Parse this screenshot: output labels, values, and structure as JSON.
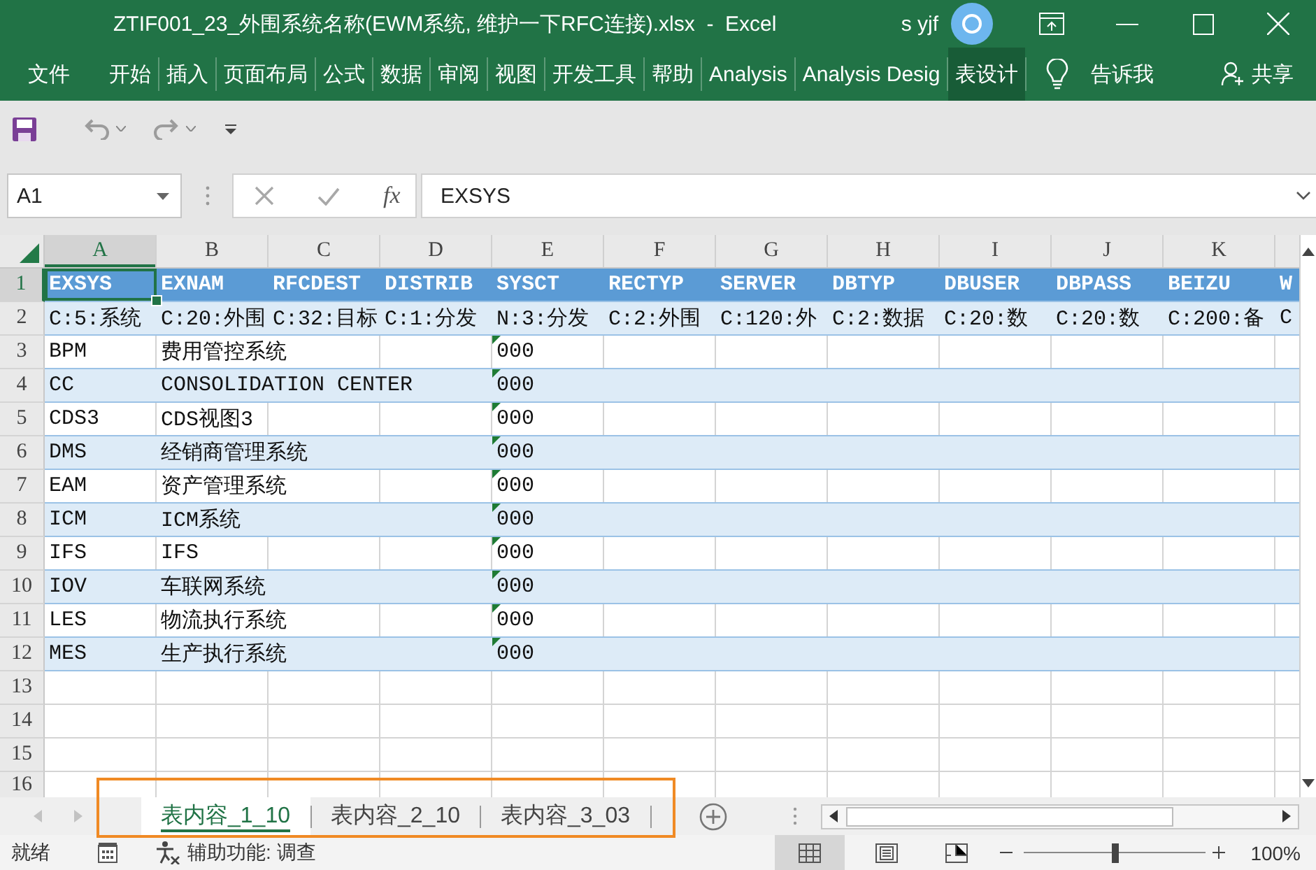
{
  "window": {
    "title": "ZTIF001_23_外围系统名称(EWM系统, 维护一下RFC连接).xlsx  -  Excel",
    "user_name": "s yjf"
  },
  "ribbon": {
    "tabs": [
      {
        "label": "文件",
        "selected": false
      },
      {
        "label": "开始",
        "selected": false
      },
      {
        "label": "插入",
        "selected": false
      },
      {
        "label": "页面布局",
        "selected": false
      },
      {
        "label": "公式",
        "selected": false
      },
      {
        "label": "数据",
        "selected": false
      },
      {
        "label": "审阅",
        "selected": false
      },
      {
        "label": "视图",
        "selected": false
      },
      {
        "label": "开发工具",
        "selected": false
      },
      {
        "label": "帮助",
        "selected": false
      },
      {
        "label": "Analysis",
        "selected": false
      },
      {
        "label": "Analysis Desig",
        "selected": false
      },
      {
        "label": "表设计",
        "selected": true
      }
    ],
    "tell_me": "告诉我",
    "share": "共享"
  },
  "quick_access": {
    "undo": {
      "disabled": true
    },
    "redo": {
      "disabled": true
    }
  },
  "formula_bar": {
    "name_box": "A1",
    "cancel": {
      "disabled": true
    },
    "enter": {
      "disabled": true
    },
    "function_label": "fx",
    "value": "EXSYS"
  },
  "sheet": {
    "columns": [
      {
        "label": "A",
        "selected": true
      },
      {
        "label": "B",
        "selected": false
      },
      {
        "label": "C",
        "selected": false
      },
      {
        "label": "D",
        "selected": false
      },
      {
        "label": "E",
        "selected": false
      },
      {
        "label": "F",
        "selected": false
      },
      {
        "label": "G",
        "selected": false
      },
      {
        "label": "H",
        "selected": false
      },
      {
        "label": "I",
        "selected": false
      },
      {
        "label": "J",
        "selected": false
      },
      {
        "label": "K",
        "selected": false
      }
    ],
    "rows": [
      {
        "number": "1",
        "kind": "header",
        "selected": true,
        "cells": [
          {
            "text": "EXSYS",
            "flagged": false
          },
          {
            "text": "EXNAM",
            "flagged": false
          },
          {
            "text": "RFCDEST",
            "flagged": false
          },
          {
            "text": "DISTRIB",
            "flagged": false
          },
          {
            "text": "SYSCT",
            "flagged": false
          },
          {
            "text": "RECTYP",
            "flagged": false
          },
          {
            "text": "SERVER",
            "flagged": false
          },
          {
            "text": "DBTYP",
            "flagged": false
          },
          {
            "text": "DBUSER",
            "flagged": false
          },
          {
            "text": "DBPASS",
            "flagged": false
          },
          {
            "text": "BEIZU",
            "flagged": false
          },
          {
            "text": "W",
            "flagged": false
          }
        ]
      },
      {
        "number": "2",
        "kind": "band",
        "selected": false,
        "cells": [
          {
            "text": "C:5:系统",
            "flagged": false
          },
          {
            "text": "C:20:外围",
            "flagged": false
          },
          {
            "text": "C:32:目标",
            "flagged": false
          },
          {
            "text": "C:1:分发",
            "flagged": false
          },
          {
            "text": "N:3:分发",
            "flagged": false
          },
          {
            "text": "C:2:外围",
            "flagged": false
          },
          {
            "text": "C:120:外",
            "flagged": false
          },
          {
            "text": "C:2:数据",
            "flagged": false
          },
          {
            "text": "C:20:数",
            "flagged": false
          },
          {
            "text": "C:20:数",
            "flagged": false
          },
          {
            "text": "C:200:备",
            "flagged": false
          },
          {
            "text": "C",
            "flagged": false
          }
        ]
      },
      {
        "number": "3",
        "kind": "plain",
        "selected": false,
        "cells": [
          {
            "text": "BPM",
            "flagged": false
          },
          {
            "text": "费用管控系统",
            "flagged": false
          },
          null,
          null,
          {
            "text": "000",
            "flagged": true
          }
        ]
      },
      {
        "number": "4",
        "kind": "band",
        "selected": false,
        "cells": [
          {
            "text": "CC",
            "flagged": false
          },
          {
            "text": "CONSOLIDATION CENTER",
            "flagged": false
          },
          null,
          null,
          {
            "text": "000",
            "flagged": true
          }
        ]
      },
      {
        "number": "5",
        "kind": "plain",
        "selected": false,
        "cells": [
          {
            "text": "CDS3",
            "flagged": false
          },
          {
            "text": "CDS视图3",
            "flagged": false
          },
          null,
          null,
          {
            "text": "000",
            "flagged": true
          }
        ]
      },
      {
        "number": "6",
        "kind": "band",
        "selected": false,
        "cells": [
          {
            "text": "DMS",
            "flagged": false
          },
          {
            "text": "经销商管理系统",
            "flagged": false
          },
          null,
          null,
          {
            "text": "000",
            "flagged": true
          }
        ]
      },
      {
        "number": "7",
        "kind": "plain",
        "selected": false,
        "cells": [
          {
            "text": "EAM",
            "flagged": false
          },
          {
            "text": "资产管理系统",
            "flagged": false
          },
          null,
          null,
          {
            "text": "000",
            "flagged": true
          }
        ]
      },
      {
        "number": "8",
        "kind": "band",
        "selected": false,
        "cells": [
          {
            "text": "ICM",
            "flagged": false
          },
          {
            "text": "ICM系统",
            "flagged": false
          },
          null,
          null,
          {
            "text": "000",
            "flagged": true
          }
        ]
      },
      {
        "number": "9",
        "kind": "plain",
        "selected": false,
        "cells": [
          {
            "text": "IFS",
            "flagged": false
          },
          {
            "text": "IFS",
            "flagged": false
          },
          null,
          null,
          {
            "text": "000",
            "flagged": true
          }
        ]
      },
      {
        "number": "10",
        "kind": "band",
        "selected": false,
        "cells": [
          {
            "text": "IOV",
            "flagged": false
          },
          {
            "text": "车联网系统",
            "flagged": false
          },
          null,
          null,
          {
            "text": "000",
            "flagged": true
          }
        ]
      },
      {
        "number": "11",
        "kind": "plain",
        "selected": false,
        "cells": [
          {
            "text": "LES",
            "flagged": false
          },
          {
            "text": "物流执行系统",
            "flagged": false
          },
          null,
          null,
          {
            "text": "000",
            "flagged": true
          }
        ]
      },
      {
        "number": "12",
        "kind": "band",
        "selected": false,
        "cells": [
          {
            "text": "MES",
            "flagged": false
          },
          {
            "text": "生产执行系统",
            "flagged": false
          },
          null,
          null,
          {
            "text": "000",
            "flagged": true
          }
        ]
      },
      {
        "number": "13",
        "kind": "blank",
        "selected": false
      },
      {
        "number": "14",
        "kind": "blank",
        "selected": false
      },
      {
        "number": "15",
        "kind": "blank",
        "selected": false
      },
      {
        "number": "16",
        "kind": "blank",
        "selected": false
      }
    ]
  },
  "sheet_tabs": [
    {
      "label": "表内容_1_10",
      "selected": true
    },
    {
      "label": "表内容_2_10",
      "selected": false
    },
    {
      "label": "表内容_3_03",
      "selected": false
    }
  ],
  "status_bar": {
    "status": "就绪",
    "accessibility": "辅助功能: 调查",
    "views": [
      {
        "kind": "normal",
        "selected": true
      },
      {
        "kind": "page_layout",
        "selected": false
      },
      {
        "kind": "page_break",
        "selected": false
      }
    ],
    "zoom": {
      "level": 0.5,
      "label": "100%"
    }
  }
}
